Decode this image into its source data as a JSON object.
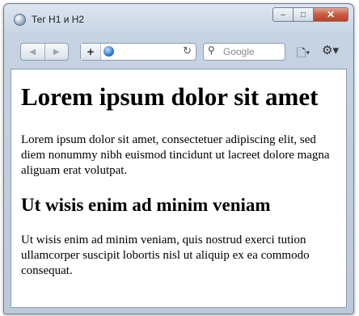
{
  "window": {
    "title": "Тег H1 и H2",
    "controls": {
      "minimize": "–",
      "maximize": "□",
      "close": "✕"
    }
  },
  "toolbar": {
    "back": "◀",
    "forward": "▶",
    "new_tab": "+",
    "reload": "↻",
    "address_value": "",
    "search_placeholder": "Google",
    "search_icon": "⚲",
    "page_menu": "🗋▾",
    "tools_menu": "⚙▾"
  },
  "page": {
    "h1": "Lorem ipsum dolor sit amet",
    "p1": "Lorem ipsum dolor sit amet, consectetuer adipiscing elit, sed diem nonummy nibh euismod tincidunt ut lacreet dolore magna aliguam erat volutpat.",
    "h2": "Ut wisis enim ad minim veniam",
    "p2": "Ut wisis enim ad minim veniam, quis nostrud exerci tution ullamcorper suscipit lobortis nisl ut aliquip ex ea commodo consequat."
  }
}
